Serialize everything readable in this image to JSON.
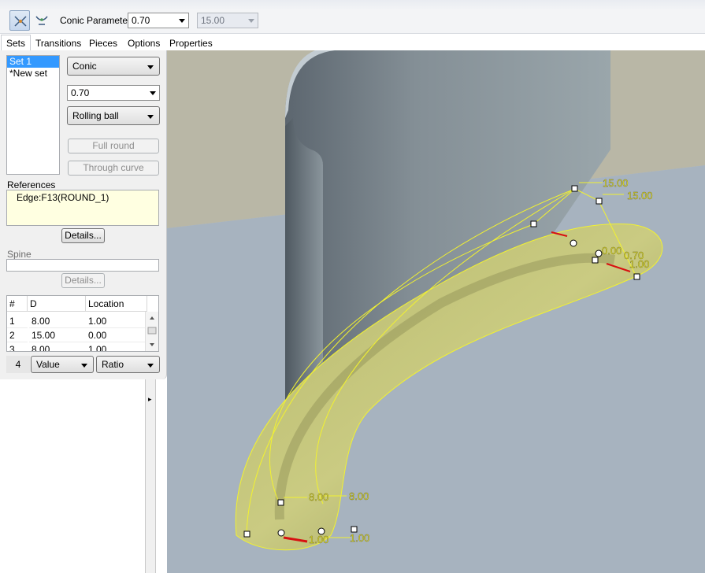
{
  "toolbar": {
    "conic_label": "Conic Parameter",
    "conic_value": "0.70",
    "second_value": "15.00",
    "icons": [
      "round-set-icon",
      "round-transition-icon"
    ]
  },
  "tabs": [
    "Sets",
    "Transitions",
    "Pieces",
    "Options",
    "Properties"
  ],
  "sets": [
    "Set 1",
    "*New set"
  ],
  "shape_type": "Conic",
  "conic_param": "0.70",
  "creation_method": "Rolling ball",
  "buttons": {
    "full_round": "Full round",
    "through_curve": "Through curve",
    "details_refs": "Details...",
    "details_spine": "Details..."
  },
  "references_label": "References",
  "reference_item": "Edge:F13(ROUND_1)",
  "spine_label": "Spine",
  "table": {
    "headers": [
      "#",
      "D",
      "Location"
    ],
    "rows": [
      [
        "1",
        "8.00",
        "1.00"
      ],
      [
        "2",
        "15.00",
        "0.00"
      ],
      [
        "3",
        "8.00",
        "1.00"
      ]
    ],
    "row_count": "4",
    "value_mode": "Value",
    "location_mode": "Ratio"
  },
  "viewport_annotations": {
    "top_a": "15.00",
    "top_b": "15.00",
    "mid_a": "0.00",
    "mid_b": "0.70",
    "mid_c": "1.00",
    "bot_a": "8.00",
    "bot_b": "8.00",
    "bot_c": "1.00",
    "bot_d": "1.00"
  },
  "colors": {
    "selection": "#3399ff",
    "round_fill": "#c9c97a",
    "annotation": "#f2f230",
    "floor": "#a7b3bf",
    "wall": "#8e9a9a"
  }
}
